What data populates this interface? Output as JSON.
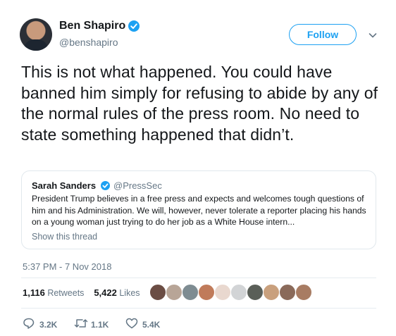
{
  "author": {
    "name": "Ben Shapiro",
    "handle": "@benshapiro"
  },
  "follow_label": "Follow",
  "tweet_text": "This is not what happened. You could have banned him simply for refusing to abide by any of the normal rules of the press room. No need to state something happened that didn’t.",
  "quoted": {
    "name": "Sarah Sanders",
    "handle": "@PressSec",
    "text": "President Trump believes in a free press and expects and welcomes tough questions of him and his Administration. We will, however, never tolerate a reporter placing his hands on a young woman just trying to do her job as a White House intern...",
    "show_thread": "Show this thread"
  },
  "timestamp": "5:37 PM - 7 Nov 2018",
  "stats": {
    "retweets_count": "1,116",
    "retweets_label": "Retweets",
    "likes_count": "5,422",
    "likes_label": "Likes"
  },
  "actions": {
    "reply_count": "3.2K",
    "retweet_count": "1.1K",
    "like_count": "5.4K"
  },
  "icons": {
    "verified": "verified-badge-icon",
    "more": "chevron-down-icon",
    "reply": "reply-icon",
    "retweet": "retweet-icon",
    "like": "heart-icon"
  },
  "colors": {
    "accent": "#1da1f2",
    "muted": "#657786",
    "border": "#e1e8ed",
    "text": "#14171a"
  }
}
